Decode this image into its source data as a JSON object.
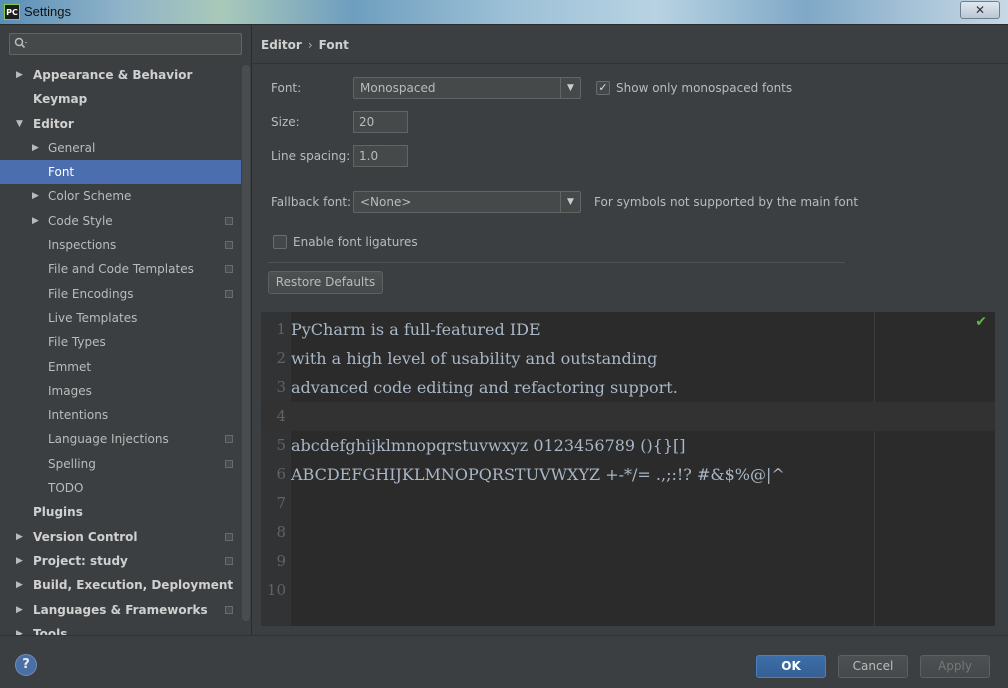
{
  "window": {
    "title": "Settings",
    "app_icon": "PC",
    "close_glyph": "✕"
  },
  "search": {
    "placeholder": "",
    "icon": "search-icon"
  },
  "tree": [
    {
      "label": "Appearance & Behavior",
      "level": 0,
      "bold": true,
      "arrow": "▶",
      "project": false
    },
    {
      "label": "Keymap",
      "level": 0,
      "bold": true,
      "arrow": "",
      "project": false
    },
    {
      "label": "Editor",
      "level": 0,
      "bold": true,
      "arrow": "▼",
      "project": false
    },
    {
      "label": "General",
      "level": 1,
      "bold": false,
      "arrow": "▶",
      "project": false
    },
    {
      "label": "Font",
      "level": 1,
      "bold": false,
      "arrow": "",
      "project": false,
      "selected": true
    },
    {
      "label": "Color Scheme",
      "level": 1,
      "bold": false,
      "arrow": "▶",
      "project": false
    },
    {
      "label": "Code Style",
      "level": 1,
      "bold": false,
      "arrow": "▶",
      "project": true
    },
    {
      "label": "Inspections",
      "level": 1,
      "bold": false,
      "arrow": "",
      "project": true
    },
    {
      "label": "File and Code Templates",
      "level": 1,
      "bold": false,
      "arrow": "",
      "project": true
    },
    {
      "label": "File Encodings",
      "level": 1,
      "bold": false,
      "arrow": "",
      "project": true
    },
    {
      "label": "Live Templates",
      "level": 1,
      "bold": false,
      "arrow": "",
      "project": false
    },
    {
      "label": "File Types",
      "level": 1,
      "bold": false,
      "arrow": "",
      "project": false
    },
    {
      "label": "Emmet",
      "level": 1,
      "bold": false,
      "arrow": "",
      "project": false
    },
    {
      "label": "Images",
      "level": 1,
      "bold": false,
      "arrow": "",
      "project": false
    },
    {
      "label": "Intentions",
      "level": 1,
      "bold": false,
      "arrow": "",
      "project": false
    },
    {
      "label": "Language Injections",
      "level": 1,
      "bold": false,
      "arrow": "",
      "project": true
    },
    {
      "label": "Spelling",
      "level": 1,
      "bold": false,
      "arrow": "",
      "project": true
    },
    {
      "label": "TODO",
      "level": 1,
      "bold": false,
      "arrow": "",
      "project": false
    },
    {
      "label": "Plugins",
      "level": 0,
      "bold": true,
      "arrow": "",
      "project": false
    },
    {
      "label": "Version Control",
      "level": 0,
      "bold": true,
      "arrow": "▶",
      "project": true
    },
    {
      "label": "Project: study",
      "level": 0,
      "bold": true,
      "arrow": "▶",
      "project": true
    },
    {
      "label": "Build, Execution, Deployment",
      "level": 0,
      "bold": true,
      "arrow": "▶",
      "project": false
    },
    {
      "label": "Languages & Frameworks",
      "level": 0,
      "bold": true,
      "arrow": "▶",
      "project": true
    },
    {
      "label": "Tools",
      "level": 0,
      "bold": true,
      "arrow": "▶",
      "project": false
    }
  ],
  "breadcrumb": {
    "parent": "Editor",
    "sep": "›",
    "current": "Font"
  },
  "form": {
    "font_label": "Font:",
    "font_value": "Monospaced",
    "show_mono_label": "Show only monospaced fonts",
    "show_mono_checked": true,
    "size_label": "Size:",
    "size_value": "20",
    "line_spacing_label": "Line spacing:",
    "line_spacing_value": "1.0",
    "fallback_label": "Fallback font:",
    "fallback_value": "<None>",
    "fallback_hint": "For symbols not supported by the main font",
    "ligatures_label": "Enable font ligatures",
    "ligatures_checked": false,
    "restore_label": "Restore Defaults",
    "drop_glyph": "▼",
    "check_glyph": "✓"
  },
  "preview": {
    "lines": [
      {
        "num": "1",
        "text": "PyCharm is a full-featured IDE"
      },
      {
        "num": "2",
        "text": "with a high level of usability and outstanding"
      },
      {
        "num": "3",
        "text": "advanced code editing and refactoring support."
      },
      {
        "num": "4",
        "text": "",
        "current": true
      },
      {
        "num": "5",
        "text": "abcdefghijklmnopqrstuvwxyz 0123456789 (){}[]"
      },
      {
        "num": "6",
        "text": "ABCDEFGHIJKLMNOPQRSTUVWXYZ +-*/= .,;:!? #&$%@|^"
      },
      {
        "num": "7",
        "text": ""
      },
      {
        "num": "8",
        "text": ""
      },
      {
        "num": "9",
        "text": ""
      },
      {
        "num": "10",
        "text": ""
      }
    ],
    "status_glyph": "✔"
  },
  "footer": {
    "help": "?",
    "ok": "OK",
    "cancel": "Cancel",
    "apply": "Apply"
  },
  "colors": {
    "selection": "#4b6eaf",
    "background": "#3c3f41",
    "editor_bg": "#2b2b2b",
    "ok_button": "#365f94"
  }
}
